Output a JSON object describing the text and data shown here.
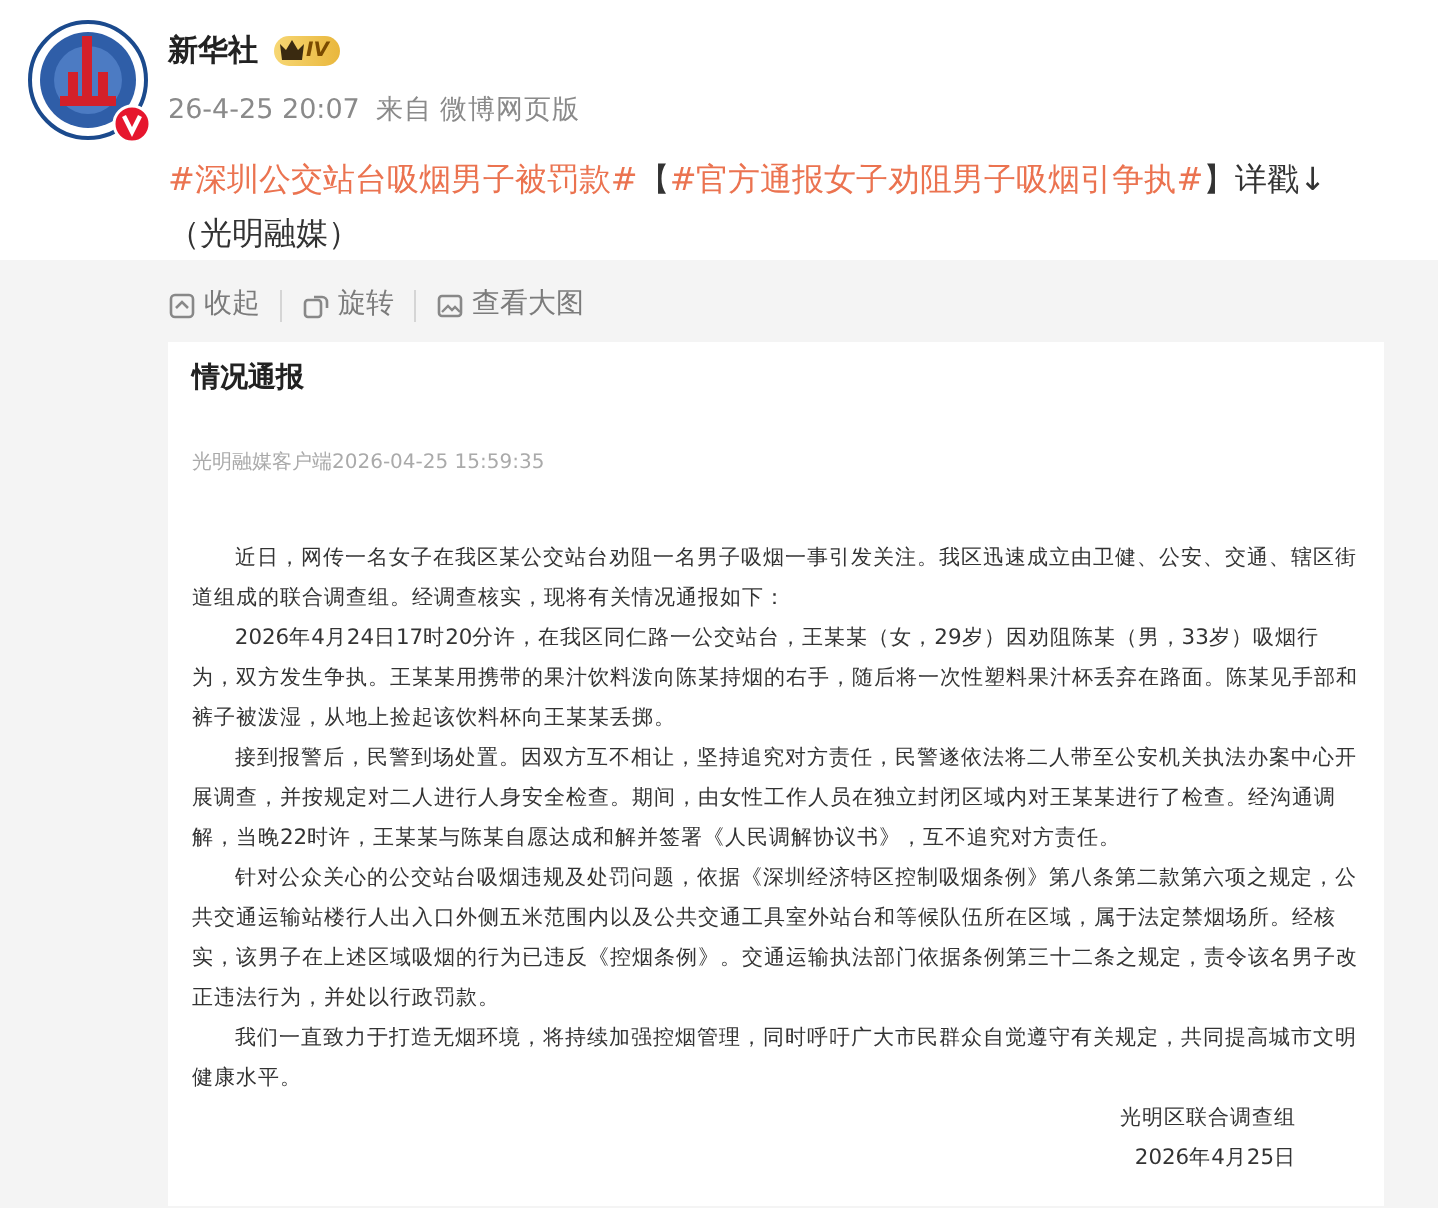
{
  "post": {
    "author": "新华社",
    "level_badge": "IV",
    "verified": true,
    "time": "26-4-25 20:07",
    "source": "来自 微博网页版",
    "text_lines": [
      [
        {
          "kind": "hashtag",
          "text": "#深圳公交站台吸烟男子被罚款#"
        },
        {
          "kind": "plain",
          "text": "【"
        },
        {
          "kind": "hashtag",
          "text": "#官方通报女子劝阻男子吸烟引争执#"
        },
        {
          "kind": "plain",
          "text": "】详戳↓"
        }
      ],
      [
        {
          "kind": "plain",
          "text": "（光明融媒）"
        }
      ]
    ]
  },
  "image_actions": [
    {
      "kind": "collapse",
      "label": "收起"
    },
    {
      "kind": "rotate",
      "label": "旋转"
    },
    {
      "kind": "enlarge",
      "label": "查看大图"
    }
  ],
  "document": {
    "title": "情况通报",
    "byline": "光明融媒客户端2026-04-25 15:59:35",
    "paragraphs": [
      "近日，网传一名女子在我区某公交站台劝阻一名男子吸烟一事引发关注。我区迅速成立由卫健、公安、交通、辖区街道组成的联合调查组。经调查核实，现将有关情况通报如下：",
      "2026年4月24日17时20分许，在我区同仁路一公交站台，王某某（女，29岁）因劝阻陈某（男，33岁）吸烟行为，双方发生争执。王某某用携带的果汁饮料泼向陈某持烟的右手，随后将一次性塑料果汁杯丢弃在路面。陈某见手部和裤子被泼湿，从地上捡起该饮料杯向王某某丢掷。",
      "接到报警后，民警到场处置。因双方互不相让，坚持追究对方责任，民警遂依法将二人带至公安机关执法办案中心开展调查，并按规定对二人进行人身安全检查。期间，由女性工作人员在独立封闭区域内对王某某进行了检查。经沟通调解，当晚22时许，王某某与陈某自愿达成和解并签署《人民调解协议书》，互不追究对方责任。",
      "针对公众关心的公交站台吸烟违规及处罚问题，依据《深圳经济特区控制吸烟条例》第八条第二款第六项之规定，公共交通运输站楼行人出入口外侧五米范围内以及公共交通工具室外站台和等候队伍所在区域，属于法定禁烟场所。经核实，该男子在上述区域吸烟的行为已违反《控烟条例》。交通运输执法部门依据条例第三十二条之规定，责令该名男子改正违法行为，并处以行政罚款。",
      "我们一直致力于打造无烟环境，将持续加强控烟管理，同时呼吁广大市民群众自觉遵守有关规定，共同提高城市文明健康水平。"
    ],
    "signature": "光明区联合调查组",
    "date": "2026年4月25日"
  }
}
